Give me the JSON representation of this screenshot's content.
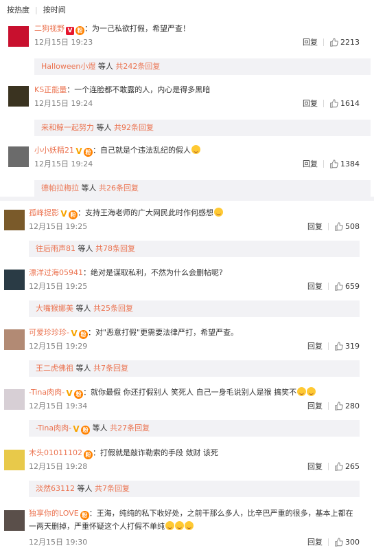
{
  "sort": {
    "hot": "按热度",
    "time": "按时间"
  },
  "labels": {
    "reply": "回复",
    "etc": "等人",
    "replies_prefix": "共",
    "replies_suffix": "条回复"
  },
  "comments": [
    {
      "user": "二狗视野",
      "text": "为一己私欲打假，希望严查！",
      "time": "12月15日 19:23",
      "likes": "2213",
      "reply_user": "Halloween小煜",
      "reply_count": "242"
    },
    {
      "user": "KS正能量",
      "text": "一个连脸都不敢露的人，内心是得多黑暗",
      "time": "12月15日 19:24",
      "likes": "1614",
      "reply_user": "来和鲸一起努力",
      "reply_count": "92"
    },
    {
      "user": "小小妖精21",
      "text": "自己就是个违法乱纪的假人",
      "time": "12月15日 19:24",
      "likes": "1384",
      "reply_user": "德帕拉梅拉",
      "reply_count": "26"
    },
    {
      "user": "孤峰捉影",
      "text": "支持王海老师的广大网民此时作何感想",
      "time": "12月15日 19:25",
      "likes": "508",
      "reply_user": "往后雨声81",
      "reply_count": "78"
    },
    {
      "user": "漂洋过海05941",
      "text": "绝对是谋取私利，不然为什么会删帖呢?",
      "time": "12月15日 19:25",
      "likes": "659",
      "reply_user": "大嘴猴娜美",
      "reply_count": "25"
    },
    {
      "user": "可爱珍珍珍-",
      "text": "对\"恶意打假\"更需要法律严打，希望严查。",
      "time": "12月15日 19:29",
      "likes": "319",
      "reply_user": "王二虎佛祖",
      "reply_count": "7"
    },
    {
      "user": "-Tina肉肉-",
      "text": "就你最假 你还打假别人 笑死人 自己一身毛说别人是猴 搞笑不",
      "time": "12月15日 19:34",
      "likes": "280",
      "reply_user": "-Tina肉肉-",
      "reply_count": "27"
    },
    {
      "user": "木头01011102",
      "text": "打假就是敲诈勒索的手段 敛财 该死",
      "time": "12月15日 19:28",
      "likes": "265",
      "reply_user": "淡然63112",
      "reply_count": "7"
    },
    {
      "user": "独享你的LOVE",
      "text": "王海，纯纯的私下收好处，之前干那么多人，比辛巴严重的很多，基本上都在",
      "text2": "一两天删掉，严重怀疑这个人打假不单纯",
      "time": "12月15日 19:30",
      "likes": "300"
    }
  ],
  "colors": {
    "username": "#eb7350",
    "meta": "#808080",
    "reply_bg": "#f2f2f5"
  },
  "icons": {
    "like": "thumbs-up-icon",
    "v": "verified-v-icon",
    "fan": "fan-badge-icon",
    "emoji": "emoji-icon"
  }
}
